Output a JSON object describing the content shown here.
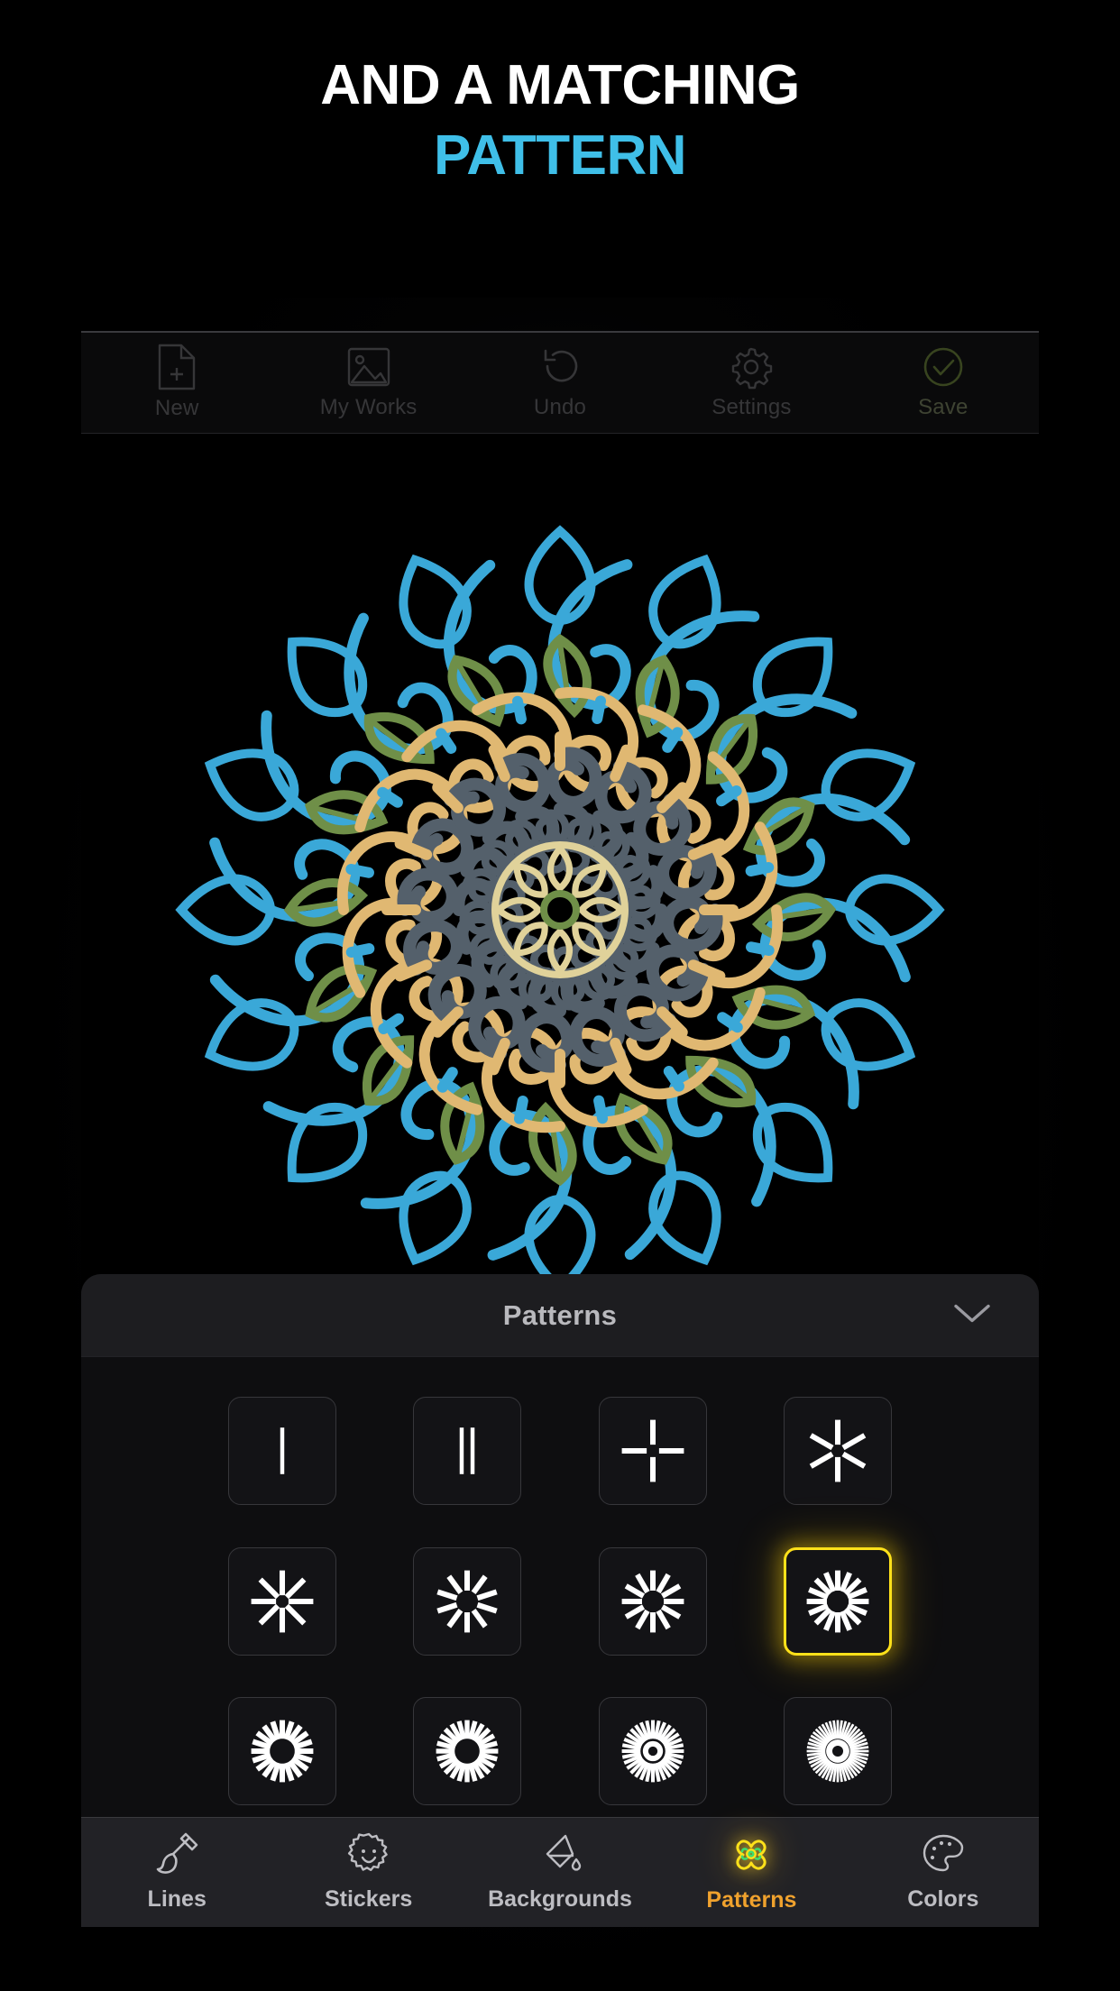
{
  "promo": {
    "line1": "AND A MATCHING",
    "line2": "PATTERN",
    "line1_color": "#ffffff",
    "line2_color": "#3fbfe8"
  },
  "toolbar": {
    "items": [
      {
        "label": "New",
        "icon": "new-file-icon"
      },
      {
        "label": "My Works",
        "icon": "image-icon"
      },
      {
        "label": "Undo",
        "icon": "undo-icon"
      },
      {
        "label": "Settings",
        "icon": "gear-icon"
      },
      {
        "label": "Save",
        "icon": "check-circle-icon",
        "color": "#6d8a3a"
      }
    ]
  },
  "panel": {
    "title": "Patterns",
    "collapse_icon": "chevron-down-icon",
    "tiles": [
      {
        "name": "pattern-1-line",
        "spokes": 1,
        "selected": false
      },
      {
        "name": "pattern-2-lines",
        "spokes": 2,
        "selected": false
      },
      {
        "name": "pattern-4-spokes",
        "spokes": 4,
        "selected": false
      },
      {
        "name": "pattern-6-spokes",
        "spokes": 6,
        "selected": false
      },
      {
        "name": "pattern-8-spokes",
        "spokes": 8,
        "selected": false
      },
      {
        "name": "pattern-10-spokes",
        "spokes": 10,
        "selected": false
      },
      {
        "name": "pattern-12-spokes",
        "spokes": 12,
        "selected": false
      },
      {
        "name": "pattern-16-spokes",
        "spokes": 16,
        "selected": true
      },
      {
        "name": "pattern-20-spokes",
        "spokes": 20,
        "selected": false
      },
      {
        "name": "pattern-24-spokes",
        "spokes": 24,
        "selected": false
      },
      {
        "name": "pattern-32-spokes",
        "spokes": 32,
        "selected": false
      },
      {
        "name": "pattern-48-spokes",
        "spokes": 48,
        "selected": false
      }
    ]
  },
  "bottom_nav": {
    "active": "Patterns",
    "items": [
      {
        "label": "Lines",
        "icon": "brush-icon",
        "active": false
      },
      {
        "label": "Stickers",
        "icon": "sticker-icon",
        "active": false
      },
      {
        "label": "Backgrounds",
        "icon": "paint-bucket-icon",
        "active": false
      },
      {
        "label": "Patterns",
        "icon": "flower-icon",
        "active": true
      },
      {
        "label": "Colors",
        "icon": "palette-icon",
        "active": false
      }
    ],
    "active_color": "#f0a22e"
  },
  "artwork": {
    "description": "Symmetric radial mandala drawing",
    "colors": {
      "blue": "#3aa8d8",
      "gold": "#e0b872",
      "green": "#6f8f48",
      "gray": "#54606b"
    }
  }
}
